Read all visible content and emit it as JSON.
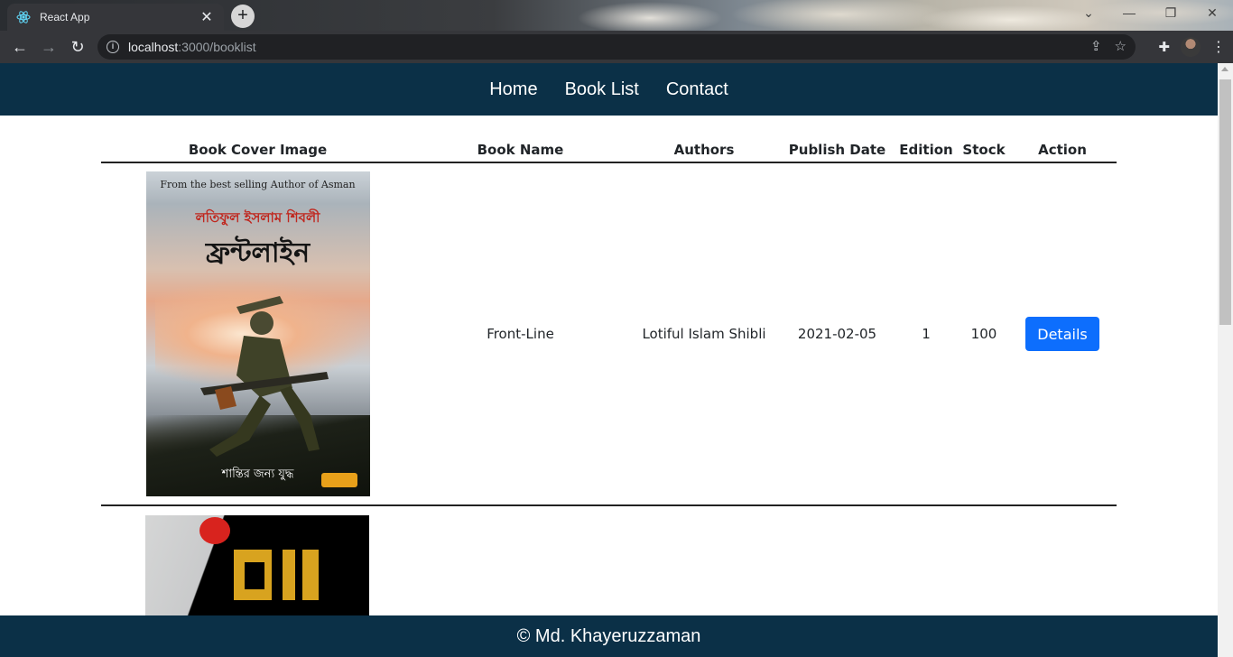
{
  "browser": {
    "tab_title": "React App",
    "url_host": "localhost",
    "url_rest": ":3000/booklist"
  },
  "nav": {
    "items": [
      "Home",
      "Book List",
      "Contact"
    ]
  },
  "table": {
    "headers": [
      "Book Cover Image",
      "Book Name",
      "Authors",
      "Publish Date",
      "Edition",
      "Stock",
      "Action"
    ],
    "rows": [
      {
        "cover": {
          "top_text": "From the best selling Author of Asman",
          "author_bn": "লতিফুল ইসলাম শিবলী",
          "title_bn": "ফ্রন্টলাইন",
          "tagline_bn": "শান্তির জন্য যুদ্ধ"
        },
        "name": "Front-Line",
        "authors": "Lotiful Islam Shibli",
        "publish_date": "2021-02-05",
        "edition": "1",
        "stock": "100",
        "action": "Details"
      }
    ]
  },
  "footer": {
    "text": "© Md. Khayeruzzaman"
  },
  "colors": {
    "navbar_bg": "#0b3047",
    "button_bg": "#0d6efd"
  }
}
